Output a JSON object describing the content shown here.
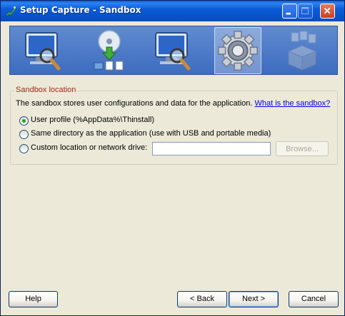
{
  "window": {
    "title": "Setup Capture - Sandbox"
  },
  "banner": {
    "steps": [
      {
        "icon": "monitor-magnifier-icon"
      },
      {
        "icon": "cd-install-icon"
      },
      {
        "icon": "monitor-magnifier-icon"
      },
      {
        "icon": "gear-icon",
        "active": true
      },
      {
        "icon": "package-files-icon",
        "disabled": true
      }
    ]
  },
  "sandbox": {
    "group_title": "Sandbox location",
    "description": "The sandbox stores user configurations and data for the application.",
    "link": "What is the sandbox?",
    "options": [
      {
        "label": "User profile (%AppData%\\Thinstall)",
        "selected": true
      },
      {
        "label": "Same directory as the application (use with USB and portable media)",
        "selected": false
      },
      {
        "label": "Custom location or network drive:",
        "selected": false
      }
    ],
    "custom_path_value": "",
    "browse_label": "Browse..."
  },
  "footer": {
    "help_label": "Help",
    "back_label": "< Back",
    "next_label": "Next >",
    "cancel_label": "Cancel"
  },
  "colors": {
    "titlebar": "#0B5BD8",
    "legend": "#A5261B",
    "link": "#0000EE",
    "radio_dot": "#21A121"
  }
}
